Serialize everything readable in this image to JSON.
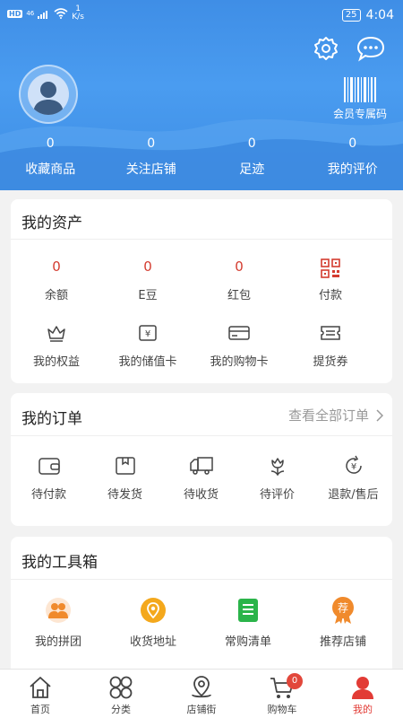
{
  "status_bar": {
    "hd": "HD",
    "signal": "46",
    "speed_num": "1",
    "speed_unit": "K/s",
    "battery": "25",
    "time": "4:04"
  },
  "header": {
    "member_code_label": "会员专属码",
    "stats": [
      {
        "value": "0",
        "label": "收藏商品"
      },
      {
        "value": "0",
        "label": "关注店铺"
      },
      {
        "value": "0",
        "label": "足迹"
      },
      {
        "value": "0",
        "label": "我的评价"
      }
    ]
  },
  "assets": {
    "title": "我的资产",
    "row1": [
      {
        "value": "0",
        "label": "余额"
      },
      {
        "value": "0",
        "label": "E豆"
      },
      {
        "value": "0",
        "label": "红包"
      },
      {
        "icon": "qr-code-icon",
        "label": "付款"
      }
    ],
    "row2": [
      {
        "icon": "crown-icon",
        "label": "我的权益"
      },
      {
        "icon": "yen-card-icon",
        "label": "我的储值卡"
      },
      {
        "icon": "credit-card-icon",
        "label": "我的购物卡"
      },
      {
        "icon": "voucher-icon",
        "label": "提货券"
      }
    ]
  },
  "orders": {
    "title": "我的订单",
    "view_all": "查看全部订单",
    "items": [
      {
        "icon": "wallet-icon",
        "label": "待付款"
      },
      {
        "icon": "package-icon",
        "label": "待发货"
      },
      {
        "icon": "truck-icon",
        "label": "待收货"
      },
      {
        "icon": "flower-icon",
        "label": "待评价"
      },
      {
        "icon": "refund-icon",
        "label": "退款/售后"
      }
    ]
  },
  "tools": {
    "title": "我的工具箱",
    "items": [
      {
        "icon": "group-icon",
        "label": "我的拼团",
        "color": "#f08a2c"
      },
      {
        "icon": "location-icon",
        "label": "收货地址",
        "color": "#f4a81c"
      },
      {
        "icon": "list-icon",
        "label": "常购清单",
        "color": "#2bb44a"
      },
      {
        "icon": "recommend-icon",
        "label": "推荐店铺",
        "badge": "荐",
        "color": "#f08a2c"
      }
    ]
  },
  "bottom_nav": {
    "items": [
      {
        "icon": "home-icon",
        "label": "首页"
      },
      {
        "icon": "category-icon",
        "label": "分类"
      },
      {
        "icon": "map-pin-icon",
        "label": "店铺街"
      },
      {
        "icon": "cart-icon",
        "label": "购物车",
        "badge": "0"
      },
      {
        "icon": "user-icon",
        "label": "我的",
        "active": true
      }
    ]
  },
  "colors": {
    "header_blue": "#3f8ee6",
    "accent_red": "#e23b35",
    "value_red": "#d43c30"
  }
}
